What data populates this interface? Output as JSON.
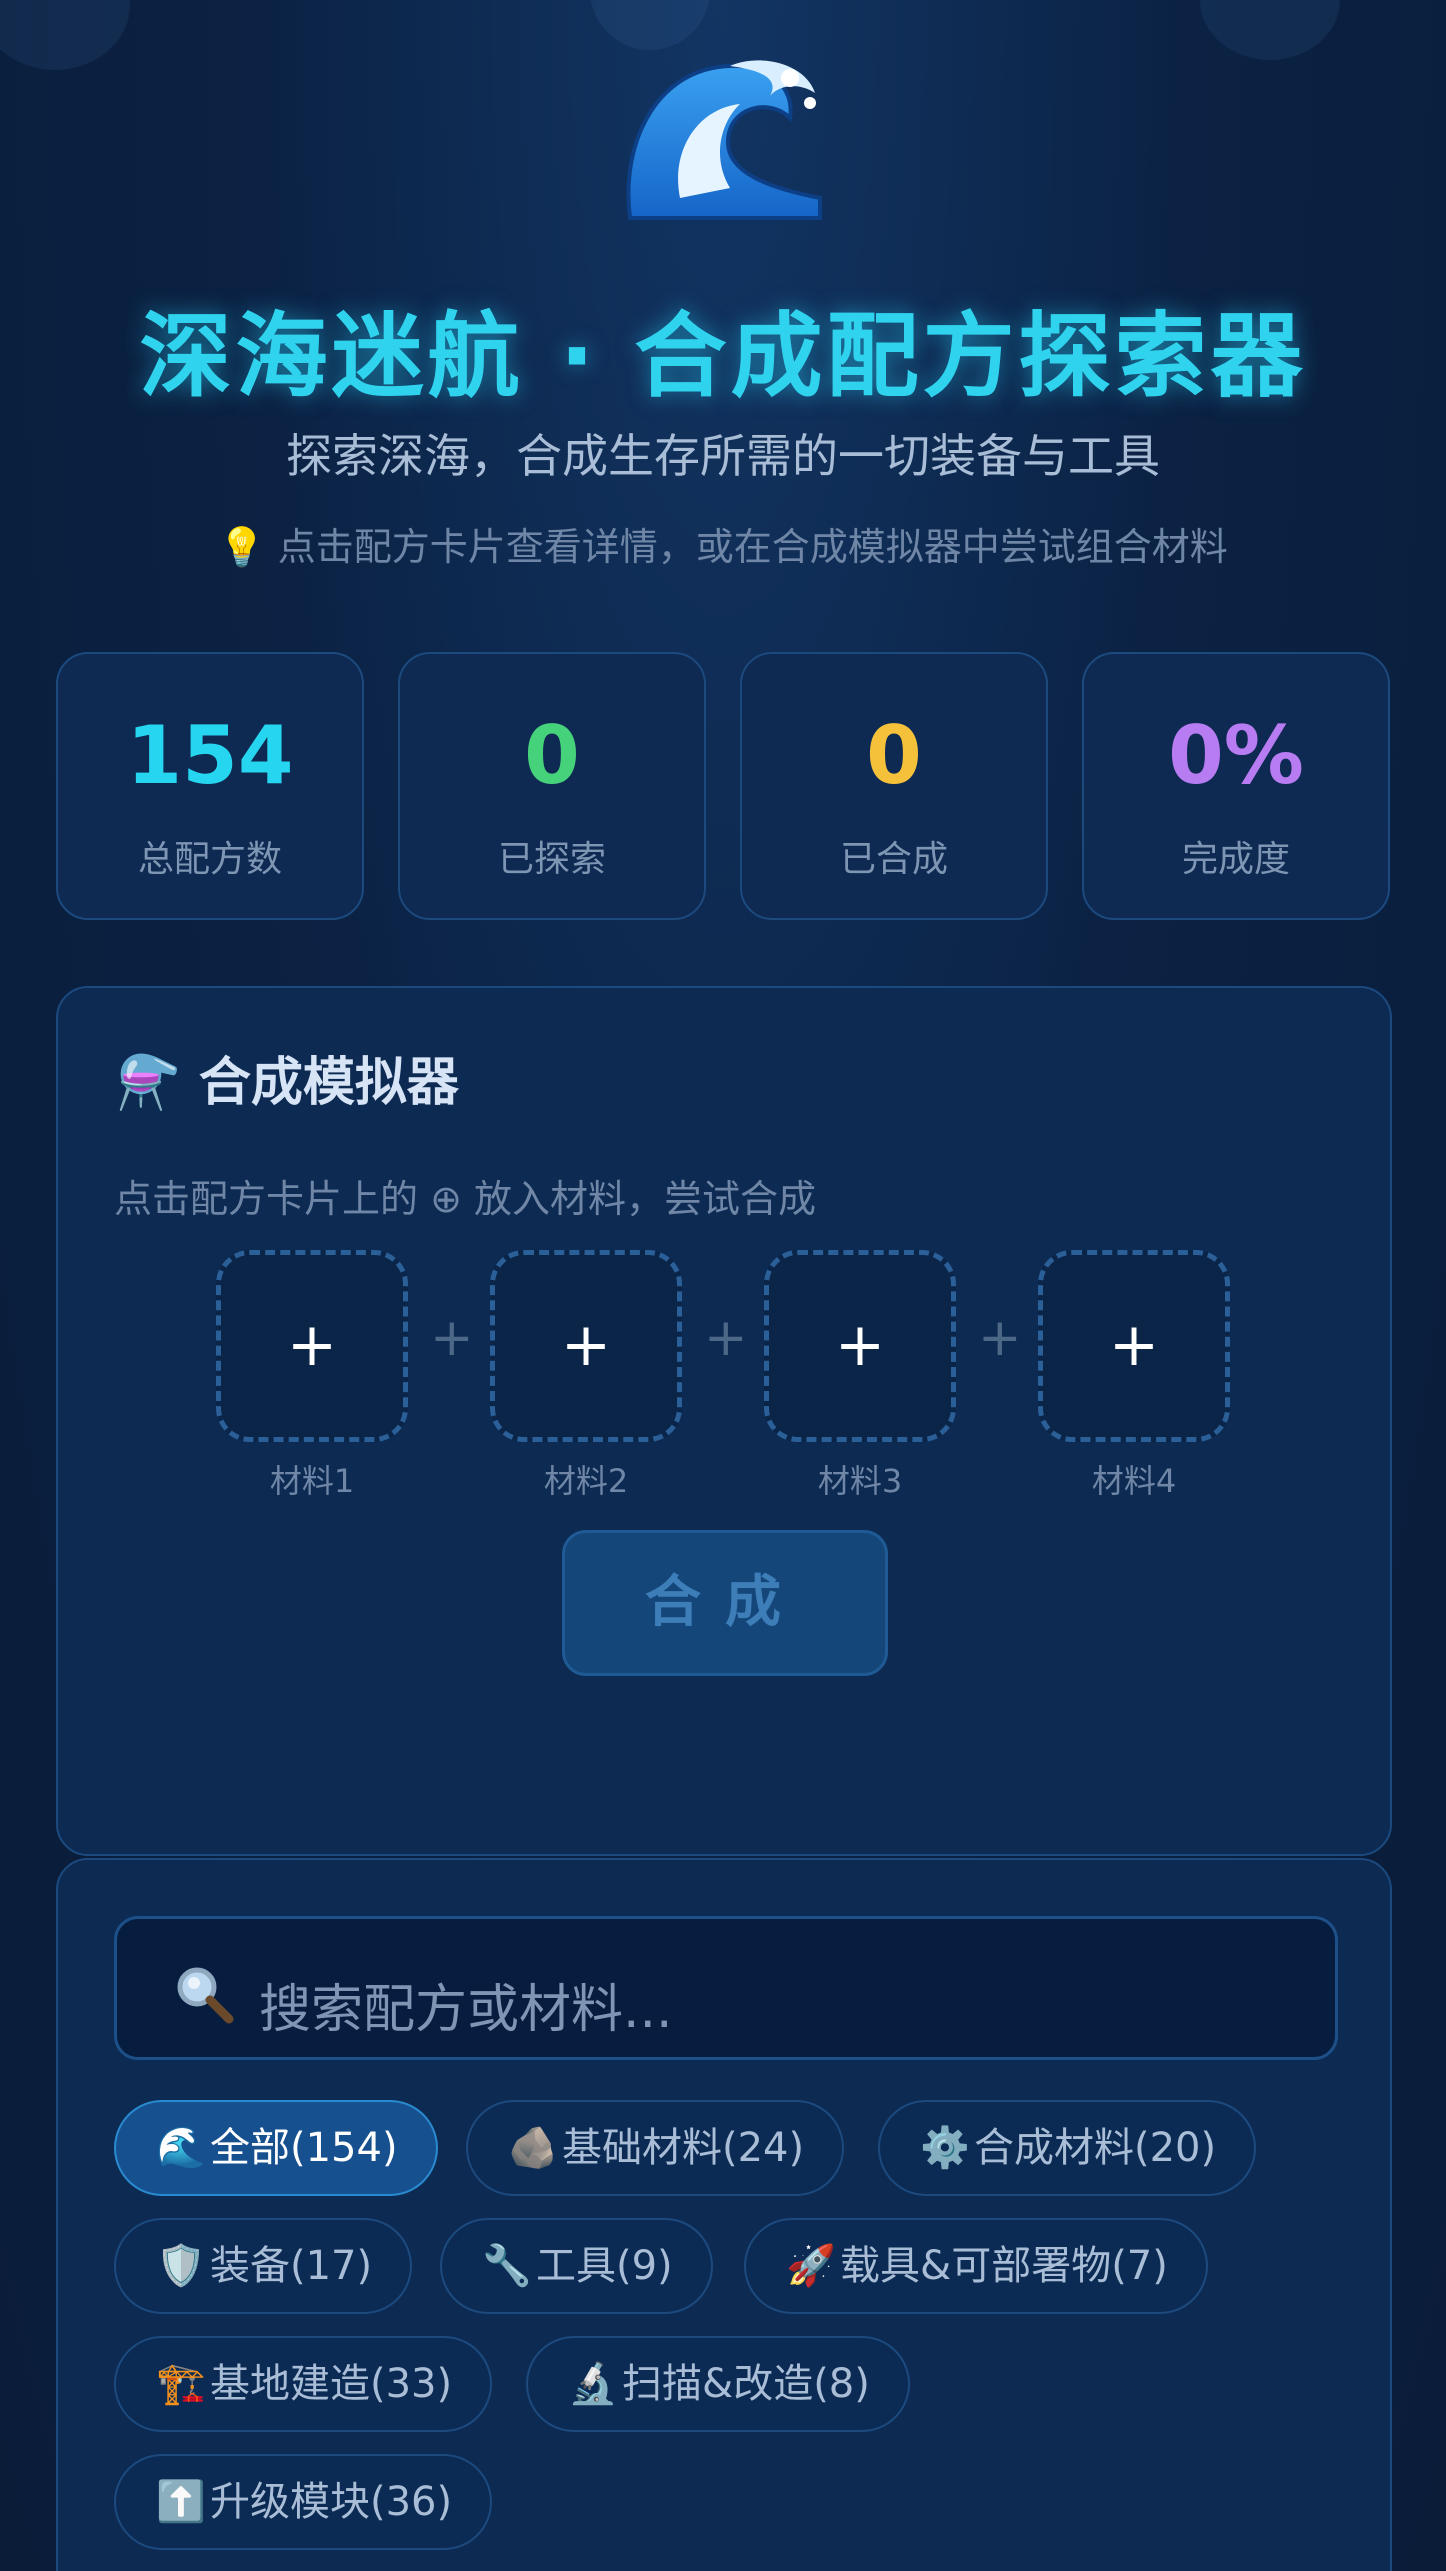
{
  "header": {
    "title": "深海迷航 · 合成配方探索器",
    "subtitle": "探索深海，合成生存所需的一切装备与工具",
    "hint": "💡 点击配方卡片查看详情，或在合成模拟器中尝试组合材料"
  },
  "stats": [
    {
      "value": "154",
      "label": "总配方数",
      "color": "#26d6f0"
    },
    {
      "value": "0",
      "label": "已探索",
      "color": "#46d27a"
    },
    {
      "value": "0",
      "label": "已合成",
      "color": "#f5c13a"
    },
    {
      "value": "0%",
      "label": "完成度",
      "color": "#b77bf2"
    }
  ],
  "simulator": {
    "icon": "⚗️",
    "title": "合成模拟器",
    "description": "点击配方卡片上的 ⊕ 放入材料，尝试合成",
    "slot_symbol": "+",
    "joiner": "+",
    "slots": [
      "材料1",
      "材料2",
      "材料3",
      "材料4"
    ],
    "craft_button": "合成"
  },
  "search": {
    "icon": "search-icon",
    "placeholder": "搜索配方或材料..."
  },
  "categories": [
    {
      "icon": "🌊",
      "label": "全部(154)",
      "active": true
    },
    {
      "icon": "🪨",
      "label": "基础材料(24)"
    },
    {
      "icon": "⚙️",
      "label": "合成材料(20)"
    },
    {
      "icon": "🛡️",
      "label": "装备(17)"
    },
    {
      "icon": "🔧",
      "label": "工具(9)"
    },
    {
      "icon": "🚀",
      "label": "载具&可部署物(7)"
    },
    {
      "icon": "🏗️",
      "label": "基地建造(33)"
    },
    {
      "icon": "🔬",
      "label": "扫描&改造(8)"
    },
    {
      "icon": "⬆️",
      "label": "升级模块(36)"
    }
  ]
}
